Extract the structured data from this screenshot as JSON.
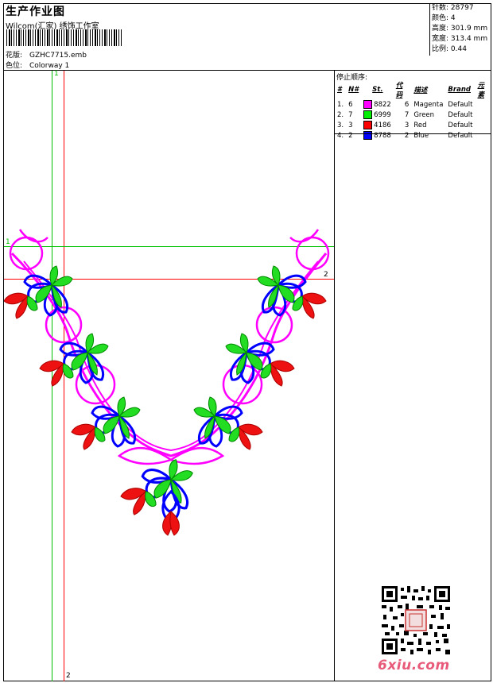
{
  "header": {
    "title": "生产作业图",
    "subtitle": "Wilcom(汇家) 绣饰工作室",
    "pattern_label": "花版:",
    "pattern_value": "GZHC7715.emb",
    "colorway_label": "色位:",
    "colorway_value": "Colorway 1"
  },
  "stats": [
    {
      "label": "针数:",
      "value": "28797"
    },
    {
      "label": "颜色:",
      "value": "4"
    },
    {
      "label": "高度:",
      "value": "301.9 mm"
    },
    {
      "label": "宽度:",
      "value": "313.4 mm"
    },
    {
      "label": "比例:",
      "value": "0.44"
    }
  ],
  "stop_sequence": {
    "title": "停止顺序:",
    "headers": [
      "#",
      "N#",
      "St.",
      "代码",
      "描述",
      "Brand",
      "元素"
    ],
    "rows": [
      {
        "num": "1.",
        "n": "6",
        "color": "#ff00ff",
        "code": "8822",
        "st": "6",
        "desc": "Magenta",
        "brand": "Default"
      },
      {
        "num": "2.",
        "n": "7",
        "color": "#00ee00",
        "code": "6999",
        "st": "7",
        "desc": "Green",
        "brand": "Default"
      },
      {
        "num": "3.",
        "n": "3",
        "color": "#ff0000",
        "code": "4186",
        "st": "3",
        "desc": "Red",
        "brand": "Default"
      },
      {
        "num": "4.",
        "n": "2",
        "color": "#0000ff",
        "code": "8788",
        "st": "2",
        "desc": "Blue",
        "brand": "Default"
      }
    ]
  },
  "guides": {
    "v1_label": "1",
    "v2_label": "2",
    "h1_label": "1",
    "h2_label": "2",
    "green": "#00c000",
    "red": "#ff0000"
  },
  "watermark": {
    "site": "6xiu.com"
  }
}
